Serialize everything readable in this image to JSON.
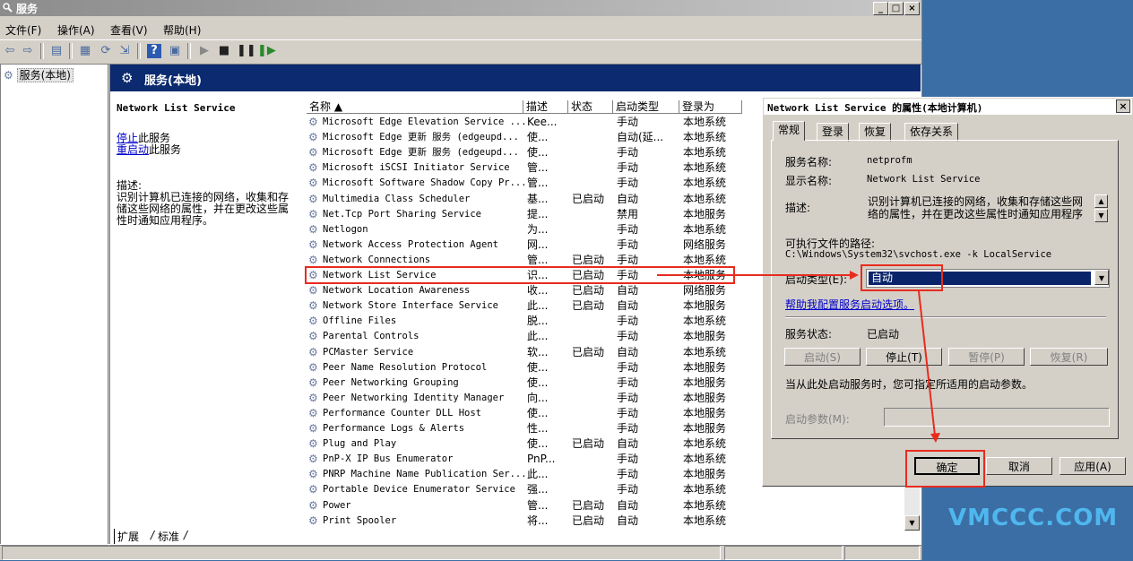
{
  "window": {
    "title": "服务",
    "min": "_",
    "max": "□",
    "close": "×"
  },
  "menu": [
    "文件(F)",
    "操作(A)",
    "查看(V)",
    "帮助(H)"
  ],
  "tree": {
    "item": "服务(本地)"
  },
  "pane": {
    "header": "服务(本地)",
    "service_title": "Network List Service",
    "stop_link": "停止",
    "stop_text": "此服务",
    "restart_link": "重启动",
    "restart_text": "此服务",
    "desc_label": "描述:",
    "desc_text": "识别计算机已连接的网络，收集和存储这些网络的属性，并在更改这些属性时通知应用程序。"
  },
  "columns": {
    "name": "名称 ▲",
    "desc": "描述",
    "status": "状态",
    "startup": "启动类型",
    "logon": "登录为"
  },
  "services": [
    {
      "name": "Microsoft Edge Elevation Service ...",
      "desc": "Kee...",
      "status": "",
      "startup": "手动",
      "logon": "本地系统"
    },
    {
      "name": "Microsoft Edge 更新 服务 (edgeupd...",
      "desc": "使...",
      "status": "",
      "startup": "自动(延...",
      "logon": "本地系统"
    },
    {
      "name": "Microsoft Edge 更新 服务 (edgeupd...",
      "desc": "使...",
      "status": "",
      "startup": "手动",
      "logon": "本地系统"
    },
    {
      "name": "Microsoft iSCSI Initiator Service",
      "desc": "管...",
      "status": "",
      "startup": "手动",
      "logon": "本地系统"
    },
    {
      "name": "Microsoft Software Shadow Copy Pr...",
      "desc": "管...",
      "status": "",
      "startup": "手动",
      "logon": "本地系统"
    },
    {
      "name": "Multimedia Class Scheduler",
      "desc": "基...",
      "status": "已启动",
      "startup": "自动",
      "logon": "本地系统"
    },
    {
      "name": "Net.Tcp Port Sharing Service",
      "desc": "提...",
      "status": "",
      "startup": "禁用",
      "logon": "本地服务"
    },
    {
      "name": "Netlogon",
      "desc": "为...",
      "status": "",
      "startup": "手动",
      "logon": "本地系统"
    },
    {
      "name": "Network Access Protection Agent",
      "desc": "网...",
      "status": "",
      "startup": "手动",
      "logon": "网络服务"
    },
    {
      "name": "Network Connections",
      "desc": "管...",
      "status": "已启动",
      "startup": "手动",
      "logon": "本地系统"
    },
    {
      "name": "Network List Service",
      "desc": "识...",
      "status": "已启动",
      "startup": "手动",
      "logon": "本地服务"
    },
    {
      "name": "Network Location Awareness",
      "desc": "收...",
      "status": "已启动",
      "startup": "自动",
      "logon": "网络服务"
    },
    {
      "name": "Network Store Interface Service",
      "desc": "此...",
      "status": "已启动",
      "startup": "自动",
      "logon": "本地服务"
    },
    {
      "name": "Offline Files",
      "desc": "脱...",
      "status": "",
      "startup": "手动",
      "logon": "本地系统"
    },
    {
      "name": "Parental Controls",
      "desc": "此...",
      "status": "",
      "startup": "手动",
      "logon": "本地服务"
    },
    {
      "name": "PCMaster Service",
      "desc": "软...",
      "status": "已启动",
      "startup": "自动",
      "logon": "本地系统"
    },
    {
      "name": "Peer Name Resolution Protocol",
      "desc": "使...",
      "status": "",
      "startup": "手动",
      "logon": "本地服务"
    },
    {
      "name": "Peer Networking Grouping",
      "desc": "使...",
      "status": "",
      "startup": "手动",
      "logon": "本地服务"
    },
    {
      "name": "Peer Networking Identity Manager",
      "desc": "向...",
      "status": "",
      "startup": "手动",
      "logon": "本地服务"
    },
    {
      "name": "Performance Counter DLL Host",
      "desc": "使...",
      "status": "",
      "startup": "手动",
      "logon": "本地服务"
    },
    {
      "name": "Performance Logs & Alerts",
      "desc": "性...",
      "status": "",
      "startup": "手动",
      "logon": "本地服务"
    },
    {
      "name": "Plug and Play",
      "desc": "使...",
      "status": "已启动",
      "startup": "自动",
      "logon": "本地系统"
    },
    {
      "name": "PnP-X IP Bus Enumerator",
      "desc": "PnP...",
      "status": "",
      "startup": "手动",
      "logon": "本地系统"
    },
    {
      "name": "PNRP Machine Name Publication Ser...",
      "desc": "此...",
      "status": "",
      "startup": "手动",
      "logon": "本地服务"
    },
    {
      "name": "Portable Device Enumerator Service",
      "desc": "强...",
      "status": "",
      "startup": "手动",
      "logon": "本地系统"
    },
    {
      "name": "Power",
      "desc": "管...",
      "status": "已启动",
      "startup": "自动",
      "logon": "本地系统"
    },
    {
      "name": "Print Spooler",
      "desc": "将...",
      "status": "已启动",
      "startup": "自动",
      "logon": "本地系统"
    }
  ],
  "bottom_tabs": {
    "extended": "扩展",
    "standard": "标准"
  },
  "dialog": {
    "title": "Network List Service 的属性(本地计算机)",
    "close": "×",
    "tabs": [
      "常规",
      "登录",
      "恢复",
      "依存关系"
    ],
    "service_name_label": "服务名称:",
    "service_name_value": "netprofm",
    "display_name_label": "显示名称:",
    "display_name_value": "Network List Service",
    "desc_label": "描述:",
    "desc_value": "识别计算机已连接的网络，收集和存储这些网络的属性，并在更改这些属性时通知应用程序",
    "path_label": "可执行文件的路径:",
    "path_value": "C:\\Windows\\System32\\svchost.exe -k LocalService",
    "startup_label": "启动类型(E):",
    "startup_value": "自动",
    "help_link": "帮助我配置服务启动选项。",
    "status_label": "服务状态:",
    "status_value": "已启动",
    "btn_start": "启动(S)",
    "btn_stop": "停止(T)",
    "btn_pause": "暂停(P)",
    "btn_resume": "恢复(R)",
    "hint": "当从此处启动服务时，您可指定所适用的启动参数。",
    "param_label": "启动参数(M):",
    "btn_ok": "确定",
    "btn_cancel": "取消",
    "btn_apply": "应用(A)"
  },
  "watermark": "vmccc.com",
  "colors": {
    "annotation": "#e82b1e",
    "header": "#0b2a6f",
    "selection": "#0a246a"
  }
}
